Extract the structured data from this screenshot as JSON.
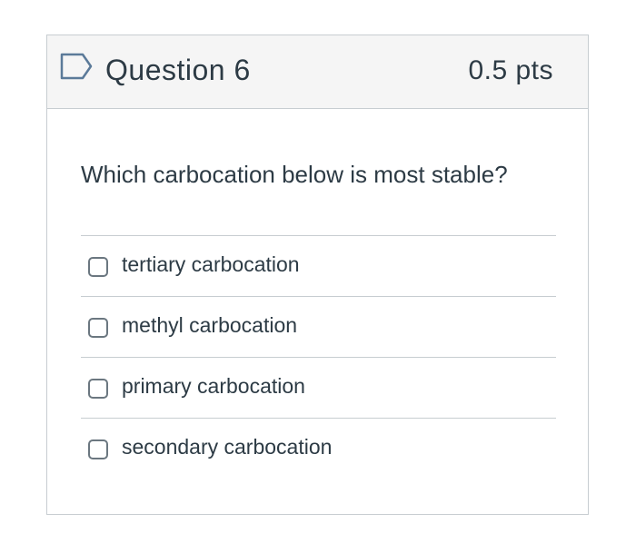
{
  "question": {
    "title": "Question 6",
    "points": "0.5 pts",
    "text": "Which carbocation below is most stable?",
    "flag_icon": "bookmark-flag-icon",
    "accent_color": "#5b7a99"
  },
  "answers": [
    {
      "label": "tertiary carbocation",
      "selected": false
    },
    {
      "label": "methyl carbocation",
      "selected": false
    },
    {
      "label": "primary carbocation",
      "selected": false
    },
    {
      "label": "secondary carbocation",
      "selected": false
    }
  ]
}
